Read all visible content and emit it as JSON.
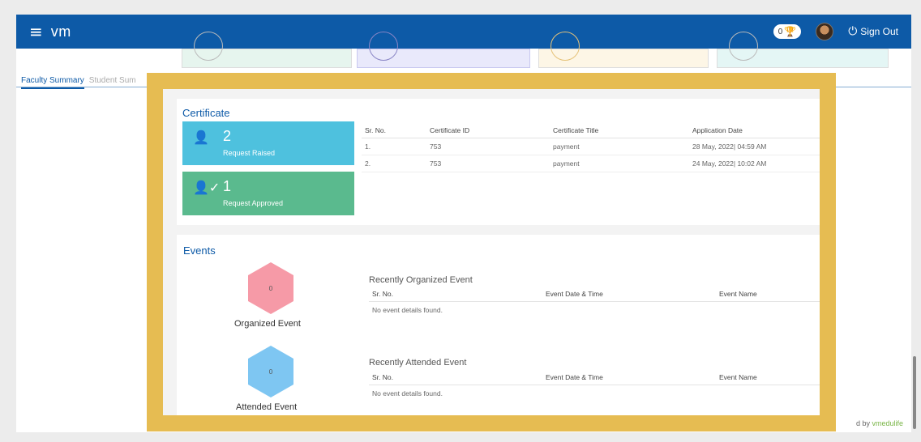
{
  "header": {
    "brand": "vm",
    "trophy_count": "0",
    "signout_label": "Sign Out"
  },
  "tabs": [
    {
      "label": "Faculty Summary"
    },
    {
      "label": "Student Sum"
    }
  ],
  "footer": {
    "prefix": "d by ",
    "brand": "vmedulife"
  },
  "certificate": {
    "title": "Certificate",
    "cards": [
      {
        "count": "2",
        "label": "Request Raised",
        "icon": "user-icon"
      },
      {
        "count": "1",
        "label": "Request Approved",
        "icon": "user-check-icon"
      }
    ],
    "table": {
      "headers": [
        "Sr. No.",
        "Certificate ID",
        "Certificate Title",
        "Application Date"
      ],
      "rows": [
        [
          "1.",
          "753",
          "payment",
          "28 May, 2022| 04:59 AM"
        ],
        [
          "2.",
          "753",
          "payment",
          "24 May, 2022| 10:02 AM"
        ]
      ]
    }
  },
  "events": {
    "title": "Events",
    "organized": {
      "count": "0",
      "label": "Organized Event"
    },
    "attended": {
      "count": "0",
      "label": "Attended Event"
    },
    "organized_table": {
      "title": "Recently Organized Event",
      "headers": [
        "Sr. No.",
        "Event Date & Time",
        "Event Name"
      ],
      "empty": "No event details found."
    },
    "attended_table": {
      "title": "Recently Attended Event",
      "headers": [
        "Sr. No.",
        "Event Date & Time",
        "Event Name"
      ],
      "empty": "No event details found."
    }
  },
  "colors": {
    "topbar": "#0d5aa7",
    "highlight_border": "#e6bc52",
    "card_raised": "#4ec1de",
    "card_approved": "#5aba8e",
    "hex_organized": "#f69aa7",
    "hex_attended": "#7ec6f2"
  }
}
